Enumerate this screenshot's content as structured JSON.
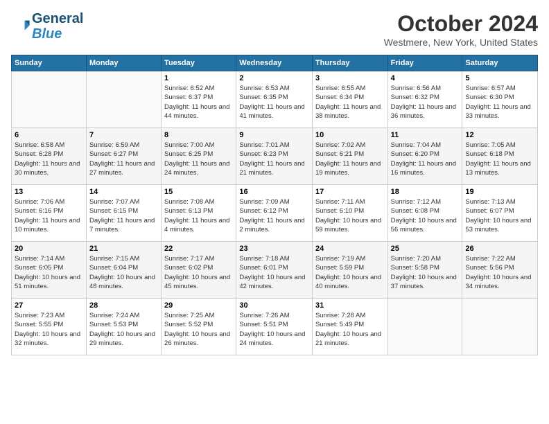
{
  "header": {
    "logo_line1": "General",
    "logo_line2": "Blue",
    "month_title": "October 2024",
    "location": "Westmere, New York, United States"
  },
  "weekdays": [
    "Sunday",
    "Monday",
    "Tuesday",
    "Wednesday",
    "Thursday",
    "Friday",
    "Saturday"
  ],
  "weeks": [
    [
      {
        "num": "",
        "info": ""
      },
      {
        "num": "",
        "info": ""
      },
      {
        "num": "1",
        "info": "Sunrise: 6:52 AM\nSunset: 6:37 PM\nDaylight: 11 hours and 44 minutes."
      },
      {
        "num": "2",
        "info": "Sunrise: 6:53 AM\nSunset: 6:35 PM\nDaylight: 11 hours and 41 minutes."
      },
      {
        "num": "3",
        "info": "Sunrise: 6:55 AM\nSunset: 6:34 PM\nDaylight: 11 hours and 38 minutes."
      },
      {
        "num": "4",
        "info": "Sunrise: 6:56 AM\nSunset: 6:32 PM\nDaylight: 11 hours and 36 minutes."
      },
      {
        "num": "5",
        "info": "Sunrise: 6:57 AM\nSunset: 6:30 PM\nDaylight: 11 hours and 33 minutes."
      }
    ],
    [
      {
        "num": "6",
        "info": "Sunrise: 6:58 AM\nSunset: 6:28 PM\nDaylight: 11 hours and 30 minutes."
      },
      {
        "num": "7",
        "info": "Sunrise: 6:59 AM\nSunset: 6:27 PM\nDaylight: 11 hours and 27 minutes."
      },
      {
        "num": "8",
        "info": "Sunrise: 7:00 AM\nSunset: 6:25 PM\nDaylight: 11 hours and 24 minutes."
      },
      {
        "num": "9",
        "info": "Sunrise: 7:01 AM\nSunset: 6:23 PM\nDaylight: 11 hours and 21 minutes."
      },
      {
        "num": "10",
        "info": "Sunrise: 7:02 AM\nSunset: 6:21 PM\nDaylight: 11 hours and 19 minutes."
      },
      {
        "num": "11",
        "info": "Sunrise: 7:04 AM\nSunset: 6:20 PM\nDaylight: 11 hours and 16 minutes."
      },
      {
        "num": "12",
        "info": "Sunrise: 7:05 AM\nSunset: 6:18 PM\nDaylight: 11 hours and 13 minutes."
      }
    ],
    [
      {
        "num": "13",
        "info": "Sunrise: 7:06 AM\nSunset: 6:16 PM\nDaylight: 11 hours and 10 minutes."
      },
      {
        "num": "14",
        "info": "Sunrise: 7:07 AM\nSunset: 6:15 PM\nDaylight: 11 hours and 7 minutes."
      },
      {
        "num": "15",
        "info": "Sunrise: 7:08 AM\nSunset: 6:13 PM\nDaylight: 11 hours and 4 minutes."
      },
      {
        "num": "16",
        "info": "Sunrise: 7:09 AM\nSunset: 6:12 PM\nDaylight: 11 hours and 2 minutes."
      },
      {
        "num": "17",
        "info": "Sunrise: 7:11 AM\nSunset: 6:10 PM\nDaylight: 10 hours and 59 minutes."
      },
      {
        "num": "18",
        "info": "Sunrise: 7:12 AM\nSunset: 6:08 PM\nDaylight: 10 hours and 56 minutes."
      },
      {
        "num": "19",
        "info": "Sunrise: 7:13 AM\nSunset: 6:07 PM\nDaylight: 10 hours and 53 minutes."
      }
    ],
    [
      {
        "num": "20",
        "info": "Sunrise: 7:14 AM\nSunset: 6:05 PM\nDaylight: 10 hours and 51 minutes."
      },
      {
        "num": "21",
        "info": "Sunrise: 7:15 AM\nSunset: 6:04 PM\nDaylight: 10 hours and 48 minutes."
      },
      {
        "num": "22",
        "info": "Sunrise: 7:17 AM\nSunset: 6:02 PM\nDaylight: 10 hours and 45 minutes."
      },
      {
        "num": "23",
        "info": "Sunrise: 7:18 AM\nSunset: 6:01 PM\nDaylight: 10 hours and 42 minutes."
      },
      {
        "num": "24",
        "info": "Sunrise: 7:19 AM\nSunset: 5:59 PM\nDaylight: 10 hours and 40 minutes."
      },
      {
        "num": "25",
        "info": "Sunrise: 7:20 AM\nSunset: 5:58 PM\nDaylight: 10 hours and 37 minutes."
      },
      {
        "num": "26",
        "info": "Sunrise: 7:22 AM\nSunset: 5:56 PM\nDaylight: 10 hours and 34 minutes."
      }
    ],
    [
      {
        "num": "27",
        "info": "Sunrise: 7:23 AM\nSunset: 5:55 PM\nDaylight: 10 hours and 32 minutes."
      },
      {
        "num": "28",
        "info": "Sunrise: 7:24 AM\nSunset: 5:53 PM\nDaylight: 10 hours and 29 minutes."
      },
      {
        "num": "29",
        "info": "Sunrise: 7:25 AM\nSunset: 5:52 PM\nDaylight: 10 hours and 26 minutes."
      },
      {
        "num": "30",
        "info": "Sunrise: 7:26 AM\nSunset: 5:51 PM\nDaylight: 10 hours and 24 minutes."
      },
      {
        "num": "31",
        "info": "Sunrise: 7:28 AM\nSunset: 5:49 PM\nDaylight: 10 hours and 21 minutes."
      },
      {
        "num": "",
        "info": ""
      },
      {
        "num": "",
        "info": ""
      }
    ]
  ]
}
